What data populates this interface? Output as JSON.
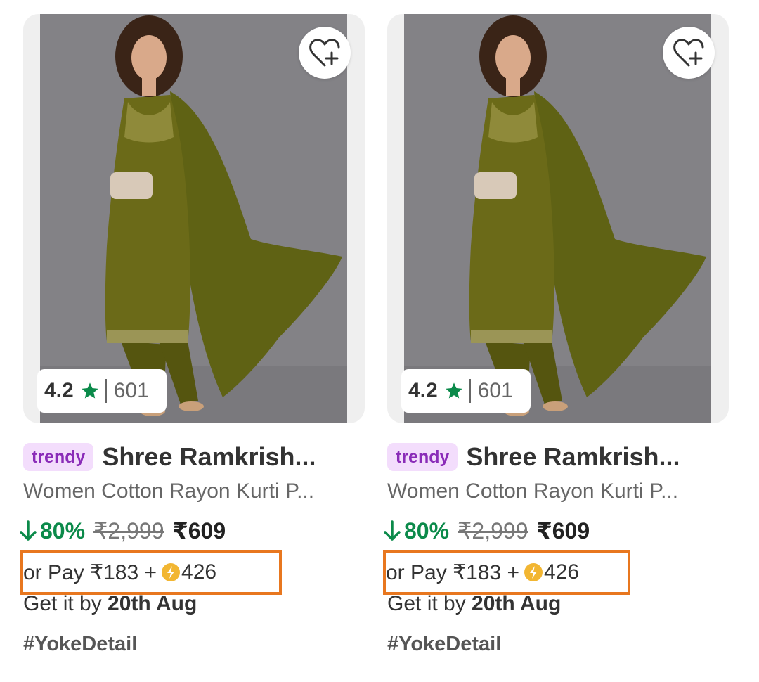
{
  "colors": {
    "discount_green": "#0b8a4a",
    "highlight_orange": "#e8771f",
    "trendy_bg": "#f3ddfc",
    "trendy_text": "#8a2bb8"
  },
  "products": [
    {
      "image_alt": "",
      "wishlist_icon": "heart-plus-icon",
      "rating": {
        "score": "4.2",
        "count": "601",
        "star_icon": "star-icon"
      },
      "badge": "trendy",
      "brand": "Shree Ramkrish...",
      "name": "Women Cotton Rayon Kurti P...",
      "discount": "80%",
      "mrp": "₹2,999",
      "price": "₹609",
      "pay_prefix": "or Pay ₹183 +",
      "pay_coins": "426",
      "delivery_prefix": "Get it by ",
      "delivery_date": "20th Aug",
      "hashtag": "#YokeDetail"
    },
    {
      "image_alt": "",
      "wishlist_icon": "heart-plus-icon",
      "rating": {
        "score": "4.2",
        "count": "601",
        "star_icon": "star-icon"
      },
      "badge": "trendy",
      "brand": "Shree Ramkrish...",
      "name": "Women Cotton Rayon Kurti P...",
      "discount": "80%",
      "mrp": "₹2,999",
      "price": "₹609",
      "pay_prefix": "or Pay ₹183 +",
      "pay_coins": "426",
      "delivery_prefix": "Get it by ",
      "delivery_date": "20th Aug",
      "hashtag": "#YokeDetail"
    }
  ]
}
